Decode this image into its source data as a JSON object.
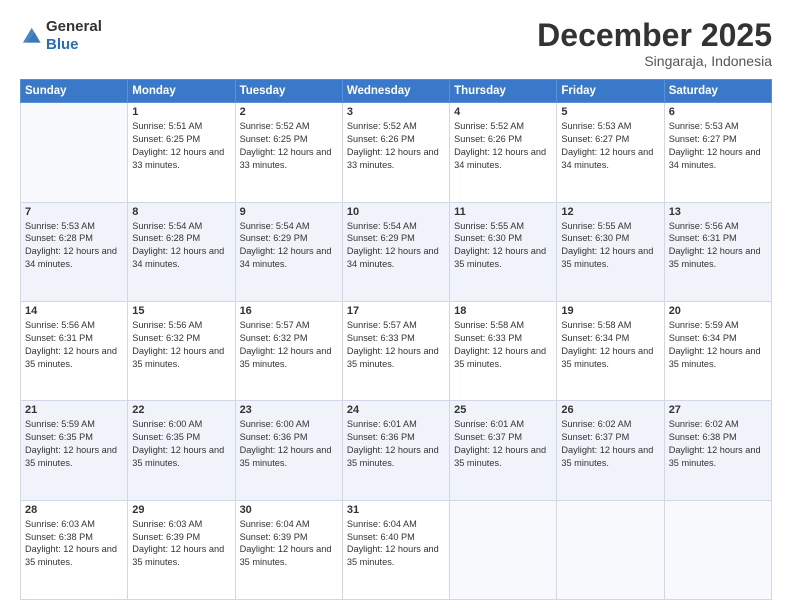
{
  "header": {
    "logo_general": "General",
    "logo_blue": "Blue",
    "month_title": "December 2025",
    "subtitle": "Singaraja, Indonesia"
  },
  "weekdays": [
    "Sunday",
    "Monday",
    "Tuesday",
    "Wednesday",
    "Thursday",
    "Friday",
    "Saturday"
  ],
  "weeks": [
    [
      {
        "day": "",
        "sunrise": "",
        "sunset": "",
        "daylight": ""
      },
      {
        "day": "1",
        "sunrise": "Sunrise: 5:51 AM",
        "sunset": "Sunset: 6:25 PM",
        "daylight": "Daylight: 12 hours and 33 minutes."
      },
      {
        "day": "2",
        "sunrise": "Sunrise: 5:52 AM",
        "sunset": "Sunset: 6:25 PM",
        "daylight": "Daylight: 12 hours and 33 minutes."
      },
      {
        "day": "3",
        "sunrise": "Sunrise: 5:52 AM",
        "sunset": "Sunset: 6:26 PM",
        "daylight": "Daylight: 12 hours and 33 minutes."
      },
      {
        "day": "4",
        "sunrise": "Sunrise: 5:52 AM",
        "sunset": "Sunset: 6:26 PM",
        "daylight": "Daylight: 12 hours and 34 minutes."
      },
      {
        "day": "5",
        "sunrise": "Sunrise: 5:53 AM",
        "sunset": "Sunset: 6:27 PM",
        "daylight": "Daylight: 12 hours and 34 minutes."
      },
      {
        "day": "6",
        "sunrise": "Sunrise: 5:53 AM",
        "sunset": "Sunset: 6:27 PM",
        "daylight": "Daylight: 12 hours and 34 minutes."
      }
    ],
    [
      {
        "day": "7",
        "sunrise": "Sunrise: 5:53 AM",
        "sunset": "Sunset: 6:28 PM",
        "daylight": "Daylight: 12 hours and 34 minutes."
      },
      {
        "day": "8",
        "sunrise": "Sunrise: 5:54 AM",
        "sunset": "Sunset: 6:28 PM",
        "daylight": "Daylight: 12 hours and 34 minutes."
      },
      {
        "day": "9",
        "sunrise": "Sunrise: 5:54 AM",
        "sunset": "Sunset: 6:29 PM",
        "daylight": "Daylight: 12 hours and 34 minutes."
      },
      {
        "day": "10",
        "sunrise": "Sunrise: 5:54 AM",
        "sunset": "Sunset: 6:29 PM",
        "daylight": "Daylight: 12 hours and 34 minutes."
      },
      {
        "day": "11",
        "sunrise": "Sunrise: 5:55 AM",
        "sunset": "Sunset: 6:30 PM",
        "daylight": "Daylight: 12 hours and 35 minutes."
      },
      {
        "day": "12",
        "sunrise": "Sunrise: 5:55 AM",
        "sunset": "Sunset: 6:30 PM",
        "daylight": "Daylight: 12 hours and 35 minutes."
      },
      {
        "day": "13",
        "sunrise": "Sunrise: 5:56 AM",
        "sunset": "Sunset: 6:31 PM",
        "daylight": "Daylight: 12 hours and 35 minutes."
      }
    ],
    [
      {
        "day": "14",
        "sunrise": "Sunrise: 5:56 AM",
        "sunset": "Sunset: 6:31 PM",
        "daylight": "Daylight: 12 hours and 35 minutes."
      },
      {
        "day": "15",
        "sunrise": "Sunrise: 5:56 AM",
        "sunset": "Sunset: 6:32 PM",
        "daylight": "Daylight: 12 hours and 35 minutes."
      },
      {
        "day": "16",
        "sunrise": "Sunrise: 5:57 AM",
        "sunset": "Sunset: 6:32 PM",
        "daylight": "Daylight: 12 hours and 35 minutes."
      },
      {
        "day": "17",
        "sunrise": "Sunrise: 5:57 AM",
        "sunset": "Sunset: 6:33 PM",
        "daylight": "Daylight: 12 hours and 35 minutes."
      },
      {
        "day": "18",
        "sunrise": "Sunrise: 5:58 AM",
        "sunset": "Sunset: 6:33 PM",
        "daylight": "Daylight: 12 hours and 35 minutes."
      },
      {
        "day": "19",
        "sunrise": "Sunrise: 5:58 AM",
        "sunset": "Sunset: 6:34 PM",
        "daylight": "Daylight: 12 hours and 35 minutes."
      },
      {
        "day": "20",
        "sunrise": "Sunrise: 5:59 AM",
        "sunset": "Sunset: 6:34 PM",
        "daylight": "Daylight: 12 hours and 35 minutes."
      }
    ],
    [
      {
        "day": "21",
        "sunrise": "Sunrise: 5:59 AM",
        "sunset": "Sunset: 6:35 PM",
        "daylight": "Daylight: 12 hours and 35 minutes."
      },
      {
        "day": "22",
        "sunrise": "Sunrise: 6:00 AM",
        "sunset": "Sunset: 6:35 PM",
        "daylight": "Daylight: 12 hours and 35 minutes."
      },
      {
        "day": "23",
        "sunrise": "Sunrise: 6:00 AM",
        "sunset": "Sunset: 6:36 PM",
        "daylight": "Daylight: 12 hours and 35 minutes."
      },
      {
        "day": "24",
        "sunrise": "Sunrise: 6:01 AM",
        "sunset": "Sunset: 6:36 PM",
        "daylight": "Daylight: 12 hours and 35 minutes."
      },
      {
        "day": "25",
        "sunrise": "Sunrise: 6:01 AM",
        "sunset": "Sunset: 6:37 PM",
        "daylight": "Daylight: 12 hours and 35 minutes."
      },
      {
        "day": "26",
        "sunrise": "Sunrise: 6:02 AM",
        "sunset": "Sunset: 6:37 PM",
        "daylight": "Daylight: 12 hours and 35 minutes."
      },
      {
        "day": "27",
        "sunrise": "Sunrise: 6:02 AM",
        "sunset": "Sunset: 6:38 PM",
        "daylight": "Daylight: 12 hours and 35 minutes."
      }
    ],
    [
      {
        "day": "28",
        "sunrise": "Sunrise: 6:03 AM",
        "sunset": "Sunset: 6:38 PM",
        "daylight": "Daylight: 12 hours and 35 minutes."
      },
      {
        "day": "29",
        "sunrise": "Sunrise: 6:03 AM",
        "sunset": "Sunset: 6:39 PM",
        "daylight": "Daylight: 12 hours and 35 minutes."
      },
      {
        "day": "30",
        "sunrise": "Sunrise: 6:04 AM",
        "sunset": "Sunset: 6:39 PM",
        "daylight": "Daylight: 12 hours and 35 minutes."
      },
      {
        "day": "31",
        "sunrise": "Sunrise: 6:04 AM",
        "sunset": "Sunset: 6:40 PM",
        "daylight": "Daylight: 12 hours and 35 minutes."
      },
      {
        "day": "",
        "sunrise": "",
        "sunset": "",
        "daylight": ""
      },
      {
        "day": "",
        "sunrise": "",
        "sunset": "",
        "daylight": ""
      },
      {
        "day": "",
        "sunrise": "",
        "sunset": "",
        "daylight": ""
      }
    ]
  ]
}
